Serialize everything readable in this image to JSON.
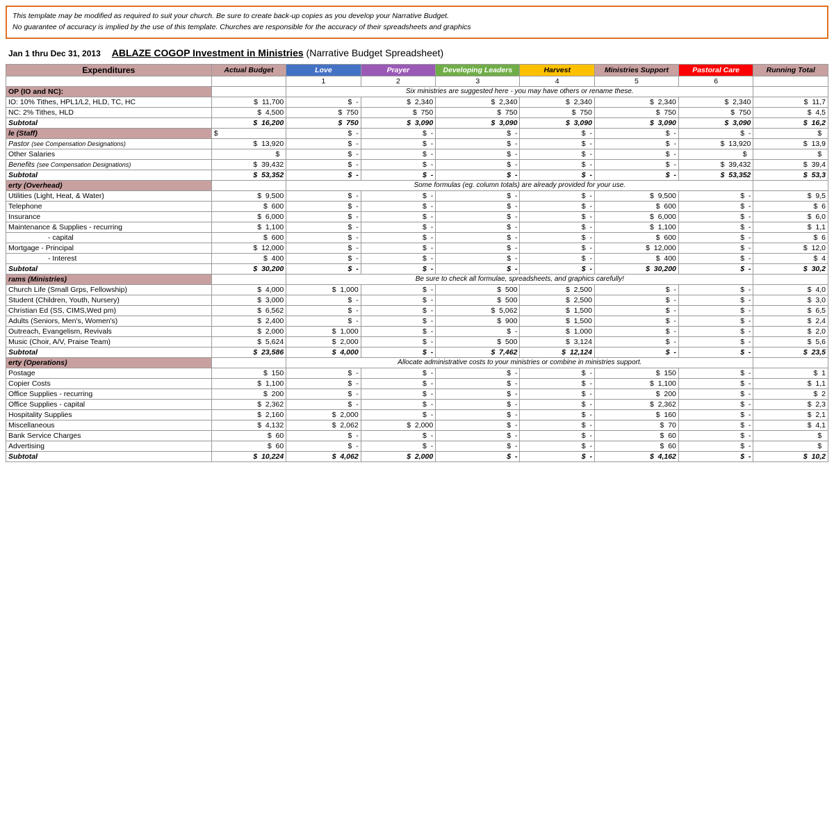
{
  "disclaimer": {
    "line1": "This template may be modified as required to suit your church.  Be sure to create back-up copies as you develop your Narrative Budget.",
    "line2": "No guarantee of accuracy is implied by the use of this template.  Churches are responsible for the accuracy of their spreadsheets and graphics"
  },
  "header": {
    "date_range": "Jan 1 thru Dec 31, 2013",
    "title_underline": "ABLAZE COGOP  Investment in Ministries",
    "title_rest": " (Narrative Budget Spreadsheet)"
  },
  "columns": {
    "expenditures": "Expenditures",
    "actual_budget": "Actual Budget",
    "love": "Love",
    "prayer": "Prayer",
    "developing": "Developing Leaders",
    "harvest": "Harvest",
    "ministries_support": "Ministries Support",
    "pastoral_care": "Pastoral Care",
    "running_total": "Running Total"
  },
  "col_numbers": {
    "love": "1",
    "prayer": "2",
    "developing": "3",
    "harvest": "4",
    "ministries": "5",
    "pastoral": "6"
  },
  "sections": {
    "op_note": "Six ministries are suggested here - you may have others or rename these.",
    "personnel_note": "",
    "property_note": "Some formulas (eg. column totals) are already provided for your use.",
    "programs_note": "Be sure to check all formulae, spreadsheets, and graphics carefully!",
    "admin_note": "Allocate administrative costs to your ministries or combine in ministries support."
  },
  "rows": {
    "op_header": "OP (IO and NC):",
    "op1_label": "IO: 10% Tithes, HPL1/L2, HLD, TC, HC",
    "op1_actual": "11,700",
    "op1_love": "-",
    "op1_prayer": "2,340",
    "op1_developing": "2,340",
    "op1_harvest": "2,340",
    "op1_ministries": "2,340",
    "op1_pastoral": "2,340",
    "op1_running": "11,7",
    "op2_label": "NC: 2% Tithes, HLD",
    "op2_actual": "4,500",
    "op2_love": "750",
    "op2_prayer": "750",
    "op2_developing": "750",
    "op2_harvest": "750",
    "op2_ministries": "750",
    "op2_pastoral": "750",
    "op2_running": "4,5",
    "op_subtotal_actual": "16,200",
    "op_subtotal_love": "750",
    "op_subtotal_prayer": "3,090",
    "op_subtotal_developing": "3,090",
    "op_subtotal_harvest": "3,090",
    "op_subtotal_ministries": "3,090",
    "op_subtotal_pastoral": "3,090",
    "op_subtotal_running": "16,2",
    "personnel_header": "le (Staff)",
    "pastor_label": "Pastor (see Compensation Designations)",
    "pastor_actual": "13,920",
    "pastor_love": "-",
    "pastor_prayer": "-",
    "pastor_developing": "-",
    "pastor_harvest": "-",
    "pastor_ministries": "-",
    "pastor_pastoral": "13,920",
    "pastor_running": "13,9",
    "salaries_label": "Other Salaries",
    "salaries_actual": "",
    "salaries_love": "-",
    "salaries_prayer": "-",
    "salaries_developing": "-",
    "salaries_harvest": "-",
    "salaries_ministries": "-",
    "salaries_pastoral": "",
    "salaries_running": "",
    "benefits_label": "Benefits (see Compensation Designations)",
    "benefits_actual": "39,432",
    "benefits_love": "-",
    "benefits_prayer": "-",
    "benefits_developing": "-",
    "benefits_harvest": "-",
    "benefits_ministries": "-",
    "benefits_pastoral": "39,432",
    "benefits_running": "39,4",
    "personnel_subtotal_actual": "53,352",
    "personnel_subtotal_love": "-",
    "personnel_subtotal_prayer": "-",
    "personnel_subtotal_developing": "-",
    "personnel_subtotal_harvest": "-",
    "personnel_subtotal_ministries": "-",
    "personnel_subtotal_pastoral": "53,352",
    "personnel_subtotal_running": "53,3",
    "property_header": "erty (Overhead)",
    "utilities_label": "Utilities (Light, Heat, & Water)",
    "utilities_actual": "9,500",
    "utilities_love": "-",
    "utilities_prayer": "-",
    "utilities_developing": "-",
    "utilities_harvest": "-",
    "utilities_ministries": "9,500",
    "utilities_pastoral": "-",
    "utilities_running": "9,5",
    "telephone_label": "Telephone",
    "telephone_actual": "600",
    "telephone_love": "-",
    "telephone_prayer": "-",
    "telephone_developing": "-",
    "telephone_harvest": "-",
    "telephone_ministries": "600",
    "telephone_pastoral": "-",
    "telephone_running": "6",
    "insurance_label": "Insurance",
    "insurance_actual": "6,000",
    "insurance_love": "-",
    "insurance_prayer": "-",
    "insurance_developing": "-",
    "insurance_harvest": "-",
    "insurance_ministries": "6,000",
    "insurance_pastoral": "-",
    "insurance_running": "6,0",
    "maintenance_label": "Maintenance & Supplies - recurring",
    "maintenance_actual": "1,100",
    "maintenance_love": "-",
    "maintenance_prayer": "-",
    "maintenance_developing": "-",
    "maintenance_harvest": "-",
    "maintenance_ministries": "1,100",
    "maintenance_pastoral": "-",
    "maintenance_running": "1,1",
    "capital_label": "- capital",
    "capital_actual": "600",
    "capital_love": "-",
    "capital_prayer": "-",
    "capital_developing": "-",
    "capital_harvest": "-",
    "capital_ministries": "600",
    "capital_pastoral": "-",
    "capital_running": "6",
    "mortgage_p_label": "Mortgage  - Principal",
    "mortgage_p_actual": "12,000",
    "mortgage_p_love": "-",
    "mortgage_p_prayer": "-",
    "mortgage_p_developing": "-",
    "mortgage_p_harvest": "-",
    "mortgage_p_ministries": "12,000",
    "mortgage_p_pastoral": "-",
    "mortgage_p_running": "12,0",
    "mortgage_i_label": "- Interest",
    "mortgage_i_actual": "400",
    "mortgage_i_love": "-",
    "mortgage_i_prayer": "-",
    "mortgage_i_developing": "-",
    "mortgage_i_harvest": "-",
    "mortgage_i_ministries": "400",
    "mortgage_i_pastoral": "-",
    "mortgage_i_running": "4",
    "property_subtotal_actual": "30,200",
    "property_subtotal_love": "-",
    "property_subtotal_prayer": "-",
    "property_subtotal_developing": "-",
    "property_subtotal_harvest": "-",
    "property_subtotal_ministries": "30,200",
    "property_subtotal_pastoral": "-",
    "property_subtotal_running": "30,2",
    "programs_header": "rams (Ministries)",
    "church_life_label": "Church Life (Small Grps, Fellowship)",
    "church_life_actual": "4,000",
    "church_life_love": "1,000",
    "church_life_prayer": "-",
    "church_life_developing": "500",
    "church_life_harvest": "2,500",
    "church_life_ministries": "-",
    "church_life_pastoral": "-",
    "church_life_running": "4,0",
    "student_label": "Student (Children, Youth, Nursery)",
    "student_actual": "3,000",
    "student_love": "-",
    "student_prayer": "-",
    "student_developing": "500",
    "student_harvest": "2,500",
    "student_ministries": "-",
    "student_pastoral": "-",
    "student_running": "3,0",
    "christian_label": "Christian Ed (SS, CIMS,Wed pm)",
    "christian_actual": "6,562",
    "christian_love": "-",
    "christian_prayer": "-",
    "christian_developing": "5,062",
    "christian_harvest": "1,500",
    "christian_ministries": "-",
    "christian_pastoral": "-",
    "christian_running": "6,5",
    "adults_label": "Adults (Seniors, Men's, Women's)",
    "adults_actual": "2,400",
    "adults_love": "-",
    "adults_prayer": "-",
    "adults_developing": "900",
    "adults_harvest": "1,500",
    "adults_ministries": "-",
    "adults_pastoral": "-",
    "adults_running": "2,4",
    "outreach_label": "Outreach, Evangelism, Revivals",
    "outreach_actual": "2,000",
    "outreach_love": "1,000",
    "outreach_prayer": "-",
    "outreach_developing": "-",
    "outreach_harvest": "1,000",
    "outreach_ministries": "-",
    "outreach_pastoral": "-",
    "outreach_running": "2,0",
    "music_label": "Music (Choir, A/V, Praise Team)",
    "music_actual": "5,624",
    "music_love": "2,000",
    "music_prayer": "-",
    "music_developing": "500",
    "music_harvest": "3,124",
    "music_ministries": "-",
    "music_pastoral": "-",
    "music_running": "5,6",
    "programs_subtotal_actual": "23,586",
    "programs_subtotal_love": "4,000",
    "programs_subtotal_prayer": "-",
    "programs_subtotal_developing": "7,462",
    "programs_subtotal_harvest": "12,124",
    "programs_subtotal_ministries": "-",
    "programs_subtotal_pastoral": "-",
    "programs_subtotal_running": "23,5",
    "admin_header": "erty (Operations)",
    "postage_label": "Postage",
    "postage_actual": "150",
    "postage_love": "-",
    "postage_prayer": "-",
    "postage_developing": "-",
    "postage_harvest": "-",
    "postage_ministries": "150",
    "postage_pastoral": "-",
    "postage_running": "1",
    "copier_label": "Copier Costs",
    "copier_actual": "1,100",
    "copier_love": "-",
    "copier_prayer": "-",
    "copier_developing": "-",
    "copier_harvest": "-",
    "copier_ministries": "1,100",
    "copier_pastoral": "-",
    "copier_running": "1,1",
    "office_rec_label": "Office Supplies - recurring",
    "office_rec_actual": "200",
    "office_rec_love": "-",
    "office_rec_prayer": "-",
    "office_rec_developing": "-",
    "office_rec_harvest": "-",
    "office_rec_ministries": "200",
    "office_rec_pastoral": "-",
    "office_rec_running": "2",
    "office_cap_label": "Office Supplies - capital",
    "office_cap_actual": "2,362",
    "office_cap_love": "-",
    "office_cap_prayer": "-",
    "office_cap_developing": "-",
    "office_cap_harvest": "-",
    "office_cap_ministries": "2,362",
    "office_cap_pastoral": "-",
    "office_cap_running": "2,3",
    "hospitality_label": "Hospitality Supplies",
    "hospitality_actual": "2,160",
    "hospitality_love": "2,000",
    "hospitality_prayer": "-",
    "hospitality_developing": "-",
    "hospitality_harvest": "-",
    "hospitality_ministries": "160",
    "hospitality_pastoral": "-",
    "hospitality_running": "2,1",
    "misc_label": "Miscellaneous",
    "misc_actual": "4,132",
    "misc_love": "2,062",
    "misc_prayer": "2,000",
    "misc_developing": "-",
    "misc_harvest": "-",
    "misc_ministries": "70",
    "misc_pastoral": "-",
    "misc_running": "4,1",
    "bank_label": "Bank Service Charges",
    "bank_actual": "60",
    "bank_love": "-",
    "bank_prayer": "-",
    "bank_developing": "-",
    "bank_harvest": "-",
    "bank_ministries": "60",
    "bank_pastoral": "-",
    "bank_running": "",
    "advertising_label": "Advertising",
    "advertising_actual": "60",
    "advertising_love": "-",
    "advertising_prayer": "-",
    "advertising_developing": "-",
    "advertising_harvest": "-",
    "advertising_ministries": "60",
    "advertising_pastoral": "-",
    "advertising_running": "",
    "admin_subtotal_actual": "10,224",
    "admin_subtotal_love": "4,062",
    "admin_subtotal_prayer": "2,000",
    "admin_subtotal_developing": "-",
    "admin_subtotal_harvest": "-",
    "admin_subtotal_ministries": "4,162",
    "admin_subtotal_pastoral": "-",
    "admin_subtotal_running": "10,2"
  }
}
